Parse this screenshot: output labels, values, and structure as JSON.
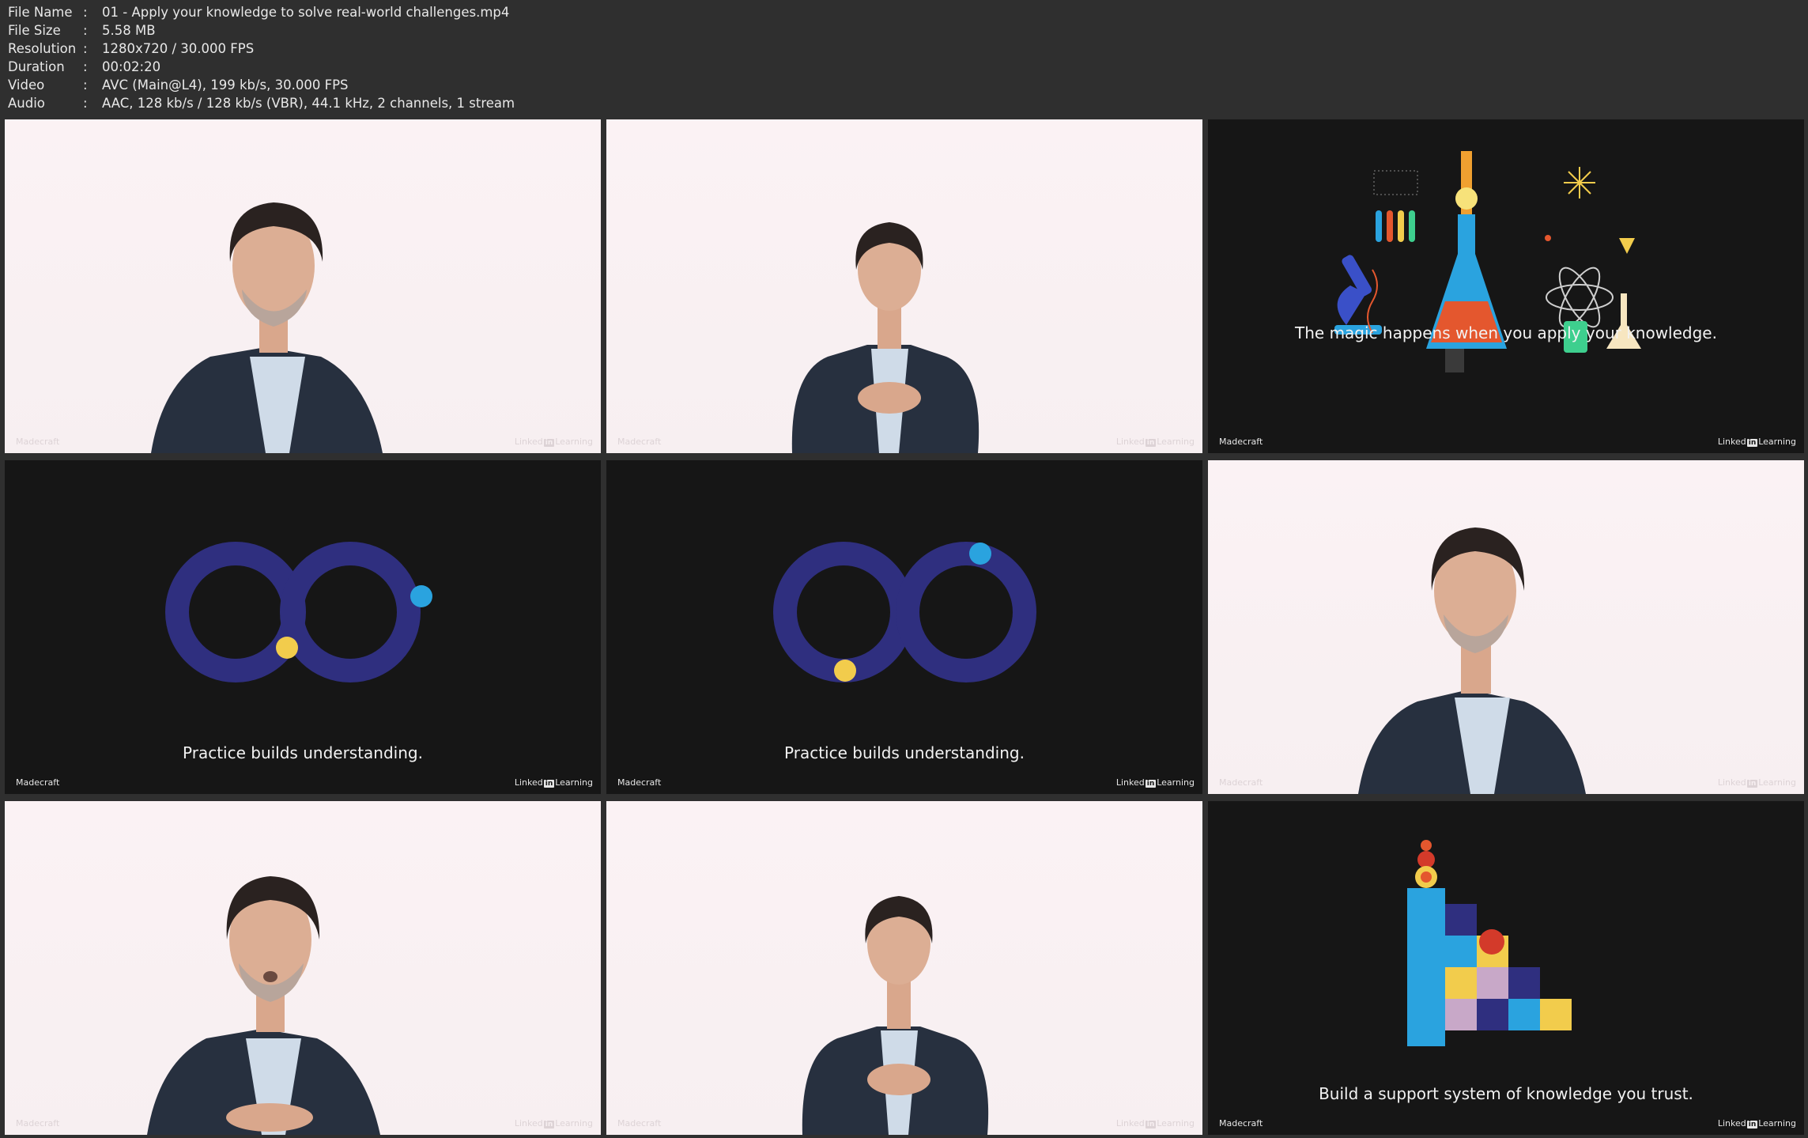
{
  "info": {
    "rows": [
      {
        "label": "File Name",
        "value": "01 - Apply your knowledge to solve real-world challenges.mp4"
      },
      {
        "label": "File Size",
        "value": "5.58 MB"
      },
      {
        "label": "Resolution",
        "value": "1280x720 / 30.000 FPS"
      },
      {
        "label": "Duration",
        "value": "00:02:20"
      },
      {
        "label": "Video",
        "value": "AVC (Main@L4), 199 kb/s, 30.000 FPS"
      },
      {
        "label": "Audio",
        "value": "AAC, 128 kb/s / 128 kb/s (VBR), 44.1 kHz, 2 channels, 1 stream"
      }
    ],
    "separator": ":"
  },
  "watermark": {
    "left": "Madecraft",
    "right_prefix": "Linked",
    "right_box": "in",
    "right_suffix": "Learning"
  },
  "frames": [
    {
      "kind": "presenter"
    },
    {
      "kind": "presenter"
    },
    {
      "kind": "science",
      "caption": "The magic happens when you apply your knowledge."
    },
    {
      "kind": "infinity",
      "caption": "Practice builds understanding."
    },
    {
      "kind": "infinity",
      "caption": "Practice builds understanding."
    },
    {
      "kind": "presenter"
    },
    {
      "kind": "presenter"
    },
    {
      "kind": "presenter"
    },
    {
      "kind": "blocks",
      "caption": "Build a support system of knowledge you trust."
    }
  ],
  "colors": {
    "background": "#2f2f2f",
    "light_frame": "#f8f0f2",
    "dark_frame": "#161616",
    "ring": "#2f2f7f",
    "dot_yellow": "#f2cc4c",
    "dot_blue": "#2aa3df"
  }
}
